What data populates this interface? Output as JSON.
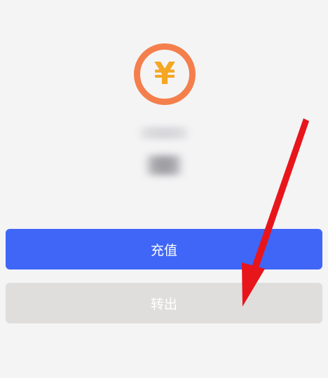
{
  "wallet": {
    "icon": "yen-coin-icon",
    "icon_glyph": "¥",
    "balance_label": "",
    "balance_amount": ""
  },
  "actions": {
    "recharge_label": "充值",
    "withdraw_label": "转出"
  },
  "colors": {
    "page_background": "#f4f4f5",
    "icon_ring": "#f47f4c",
    "icon_glyph": "#f5a623",
    "recharge_button": "#3f66f6",
    "withdraw_button": "#dfdedd",
    "annotation_arrow": "#e8151b"
  },
  "annotation": {
    "icon": "red-arrow-icon"
  }
}
